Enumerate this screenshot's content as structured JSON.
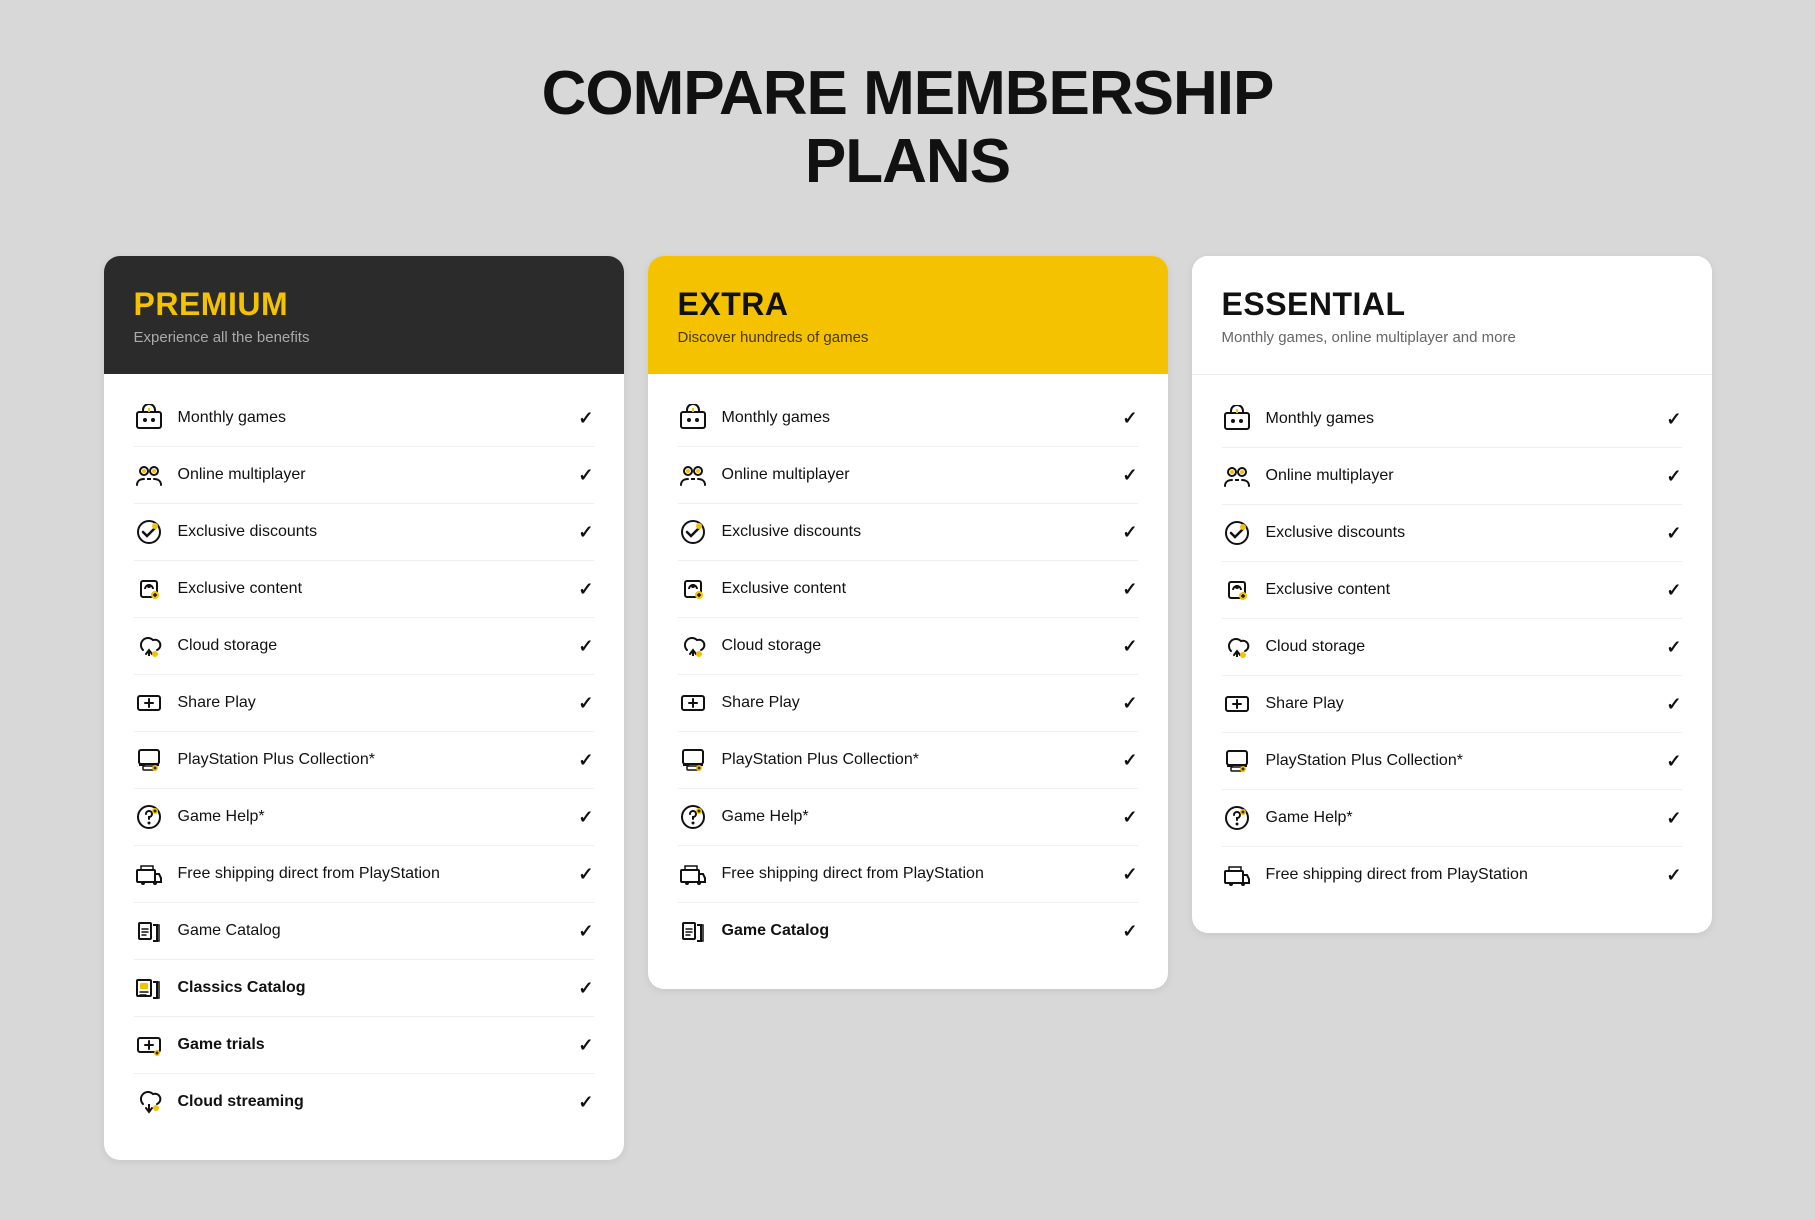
{
  "page": {
    "title_line1": "COMPARE MEMBERSHIP",
    "title_line2": "PLANS"
  },
  "plans": [
    {
      "id": "premium",
      "name": "PREMIUM",
      "subtitle": "Experience all the benefits",
      "header_theme": "premium",
      "features": [
        {
          "label": "Monthly games",
          "bold": false,
          "icon": "🎮",
          "checked": true
        },
        {
          "label": "Online multiplayer",
          "bold": false,
          "icon": "👥",
          "checked": true
        },
        {
          "label": "Exclusive discounts",
          "bold": false,
          "icon": "🏷️",
          "checked": true
        },
        {
          "label": "Exclusive content",
          "bold": false,
          "icon": "⚙️",
          "checked": true
        },
        {
          "label": "Cloud storage",
          "bold": false,
          "icon": "☁️",
          "checked": true
        },
        {
          "label": "Share Play",
          "bold": false,
          "icon": "🎮",
          "checked": true
        },
        {
          "label": "PlayStation Plus Collection*",
          "bold": false,
          "icon": "🖼️",
          "checked": true
        },
        {
          "label": "Game Help*",
          "bold": false,
          "icon": "💡",
          "checked": true
        },
        {
          "label": "Free shipping direct from PlayStation",
          "bold": false,
          "icon": "🚚",
          "checked": true
        },
        {
          "label": "Game Catalog",
          "bold": false,
          "icon": "📋",
          "checked": true
        },
        {
          "label": "Classics Catalog",
          "bold": true,
          "icon": "🎲",
          "checked": true
        },
        {
          "label": "Game trials",
          "bold": true,
          "icon": "🎮",
          "checked": true
        },
        {
          "label": "Cloud streaming",
          "bold": true,
          "icon": "☁️",
          "checked": true
        }
      ]
    },
    {
      "id": "extra",
      "name": "EXTRA",
      "subtitle": "Discover hundreds of games",
      "header_theme": "extra",
      "features": [
        {
          "label": "Monthly games",
          "bold": false,
          "icon": "🎮",
          "checked": true
        },
        {
          "label": "Online multiplayer",
          "bold": false,
          "icon": "👥",
          "checked": true
        },
        {
          "label": "Exclusive discounts",
          "bold": false,
          "icon": "🏷️",
          "checked": true
        },
        {
          "label": "Exclusive content",
          "bold": false,
          "icon": "⚙️",
          "checked": true
        },
        {
          "label": "Cloud storage",
          "bold": false,
          "icon": "☁️",
          "checked": true
        },
        {
          "label": "Share Play",
          "bold": false,
          "icon": "🎮",
          "checked": true
        },
        {
          "label": "PlayStation Plus Collection*",
          "bold": false,
          "icon": "🖼️",
          "checked": true
        },
        {
          "label": "Game Help*",
          "bold": false,
          "icon": "💡",
          "checked": true
        },
        {
          "label": "Free shipping direct from PlayStation",
          "bold": false,
          "icon": "🚚",
          "checked": true
        },
        {
          "label": "Game Catalog",
          "bold": true,
          "icon": "📋",
          "checked": true
        }
      ]
    },
    {
      "id": "essential",
      "name": "ESSENTIAL",
      "subtitle": "Monthly games, online multiplayer and more",
      "header_theme": "essential",
      "features": [
        {
          "label": "Monthly games",
          "bold": false,
          "icon": "🎮",
          "checked": true
        },
        {
          "label": "Online multiplayer",
          "bold": false,
          "icon": "👥",
          "checked": true
        },
        {
          "label": "Exclusive discounts",
          "bold": false,
          "icon": "🏷️",
          "checked": true
        },
        {
          "label": "Exclusive content",
          "bold": false,
          "icon": "⚙️",
          "checked": true
        },
        {
          "label": "Cloud storage",
          "bold": false,
          "icon": "☁️",
          "checked": true
        },
        {
          "label": "Share Play",
          "bold": false,
          "icon": "🎮",
          "checked": true
        },
        {
          "label": "PlayStation Plus Collection*",
          "bold": false,
          "icon": "🖼️",
          "checked": true
        },
        {
          "label": "Game Help*",
          "bold": false,
          "icon": "💡",
          "checked": true
        },
        {
          "label": "Free shipping direct from PlayStation",
          "bold": false,
          "icon": "🚚",
          "checked": true
        }
      ]
    }
  ],
  "icons": {
    "monthly_games": "🎁",
    "online_multiplayer": "👥",
    "exclusive_discounts": "🏷️",
    "exclusive_content": "⚙️",
    "cloud_storage": "☁️",
    "share_play": "🎮",
    "ps_plus_collection": "🖼️",
    "game_help": "💡",
    "free_shipping": "🚚",
    "game_catalog": "📋",
    "classics_catalog": "🎲",
    "game_trials": "🎮",
    "cloud_streaming": "⛅",
    "checkmark": "✓"
  },
  "feature_icons_unicode": {
    "monthly_games": "🎁",
    "online_multiplayer": "👥",
    "exclusive_discounts": "🏷️",
    "exclusive_content": "🔧",
    "cloud_storage": "☁️",
    "share_play": "🎮",
    "ps_collection": "🖼️",
    "game_help": "💡",
    "free_shipping": "🚚",
    "game_catalog": "📊",
    "classics_catalog": "🎲",
    "game_trials": "🎮",
    "cloud_streaming": "🌐"
  }
}
